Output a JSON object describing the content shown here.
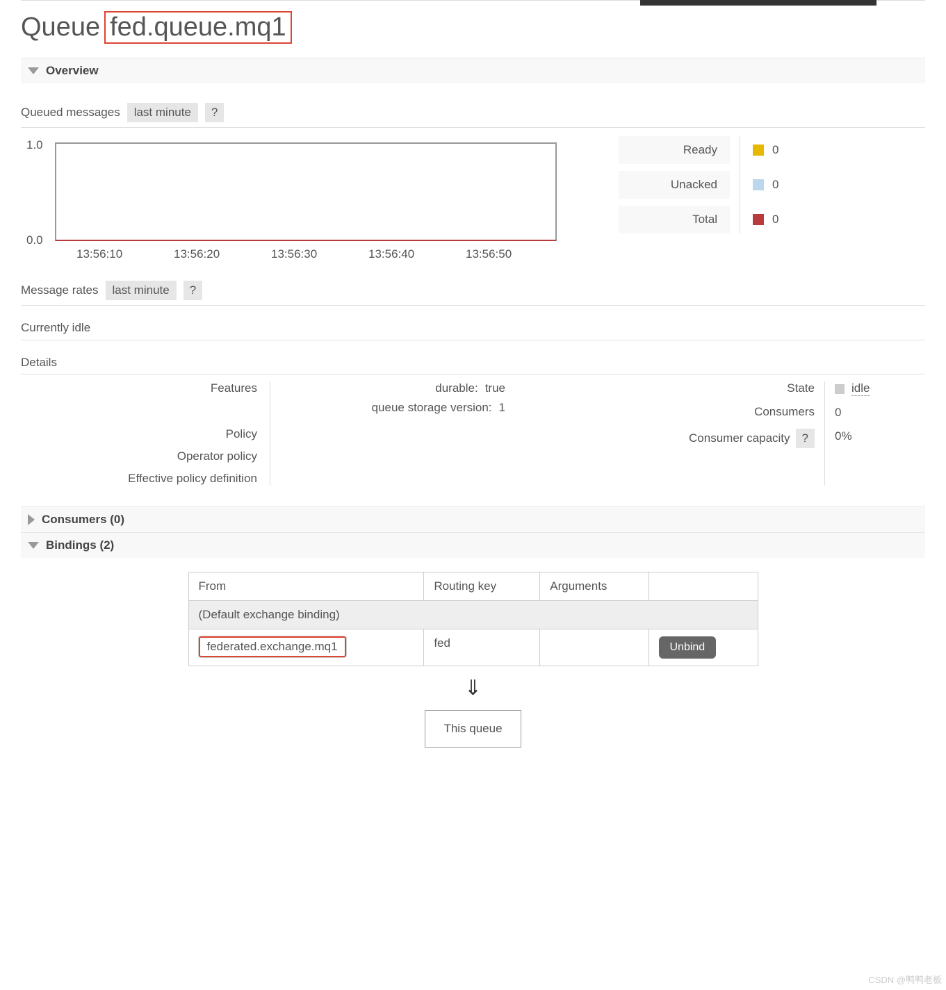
{
  "chart_data": {
    "type": "line",
    "title": "Queued messages",
    "range_label": "last minute",
    "categories": [
      "13:56:10",
      "13:56:20",
      "13:56:30",
      "13:56:40",
      "13:56:50"
    ],
    "ylim": [
      0.0,
      1.0
    ],
    "yticks": [
      0.0,
      1.0
    ],
    "series": [
      {
        "name": "Ready",
        "values": [
          0,
          0,
          0,
          0,
          0
        ],
        "color": "#e6b800"
      },
      {
        "name": "Unacked",
        "values": [
          0,
          0,
          0,
          0,
          0
        ],
        "color": "#bcd6ee"
      },
      {
        "name": "Total",
        "values": [
          0,
          0,
          0,
          0,
          0
        ],
        "color": "#b73b3b"
      }
    ]
  },
  "title": {
    "prefix": "Queue",
    "name": "fed.queue.mq1"
  },
  "sections": {
    "overview": "Overview",
    "consumers": "Consumers (0)",
    "bindings": "Bindings (2)"
  },
  "overview": {
    "queued": {
      "label": "Queued messages",
      "range": "last minute",
      "help": "?"
    },
    "rates": {
      "label": "Message rates",
      "range": "last minute",
      "help": "?"
    },
    "idle": "Currently idle",
    "details_label": "Details",
    "legend": {
      "ready": {
        "label": "Ready",
        "value": "0"
      },
      "unacked": {
        "label": "Unacked",
        "value": "0"
      },
      "total": {
        "label": "Total",
        "value": "0"
      }
    }
  },
  "details": {
    "left_labels": {
      "features": "Features",
      "policy": "Policy",
      "operator_policy": "Operator policy",
      "effective": "Effective policy definition"
    },
    "features_kv": {
      "durable_k": "durable:",
      "durable_v": "true",
      "qsv_k": "queue storage version:",
      "qsv_v": "1"
    },
    "right": {
      "state_l": "State",
      "state_v": "idle",
      "consumers_l": "Consumers",
      "consumers_v": "0",
      "capacity_l": "Consumer capacity",
      "capacity_h": "?",
      "capacity_v": "0%"
    }
  },
  "bindings": {
    "headers": {
      "from": "From",
      "rk": "Routing key",
      "args": "Arguments"
    },
    "default_row": "(Default exchange binding)",
    "row": {
      "from": "federated.exchange.mq1",
      "rk": "fed",
      "args": "",
      "unbind": "Unbind"
    },
    "arrow": "⇓",
    "this_queue": "This queue"
  },
  "watermark": "CSDN @鸭鸭老板"
}
